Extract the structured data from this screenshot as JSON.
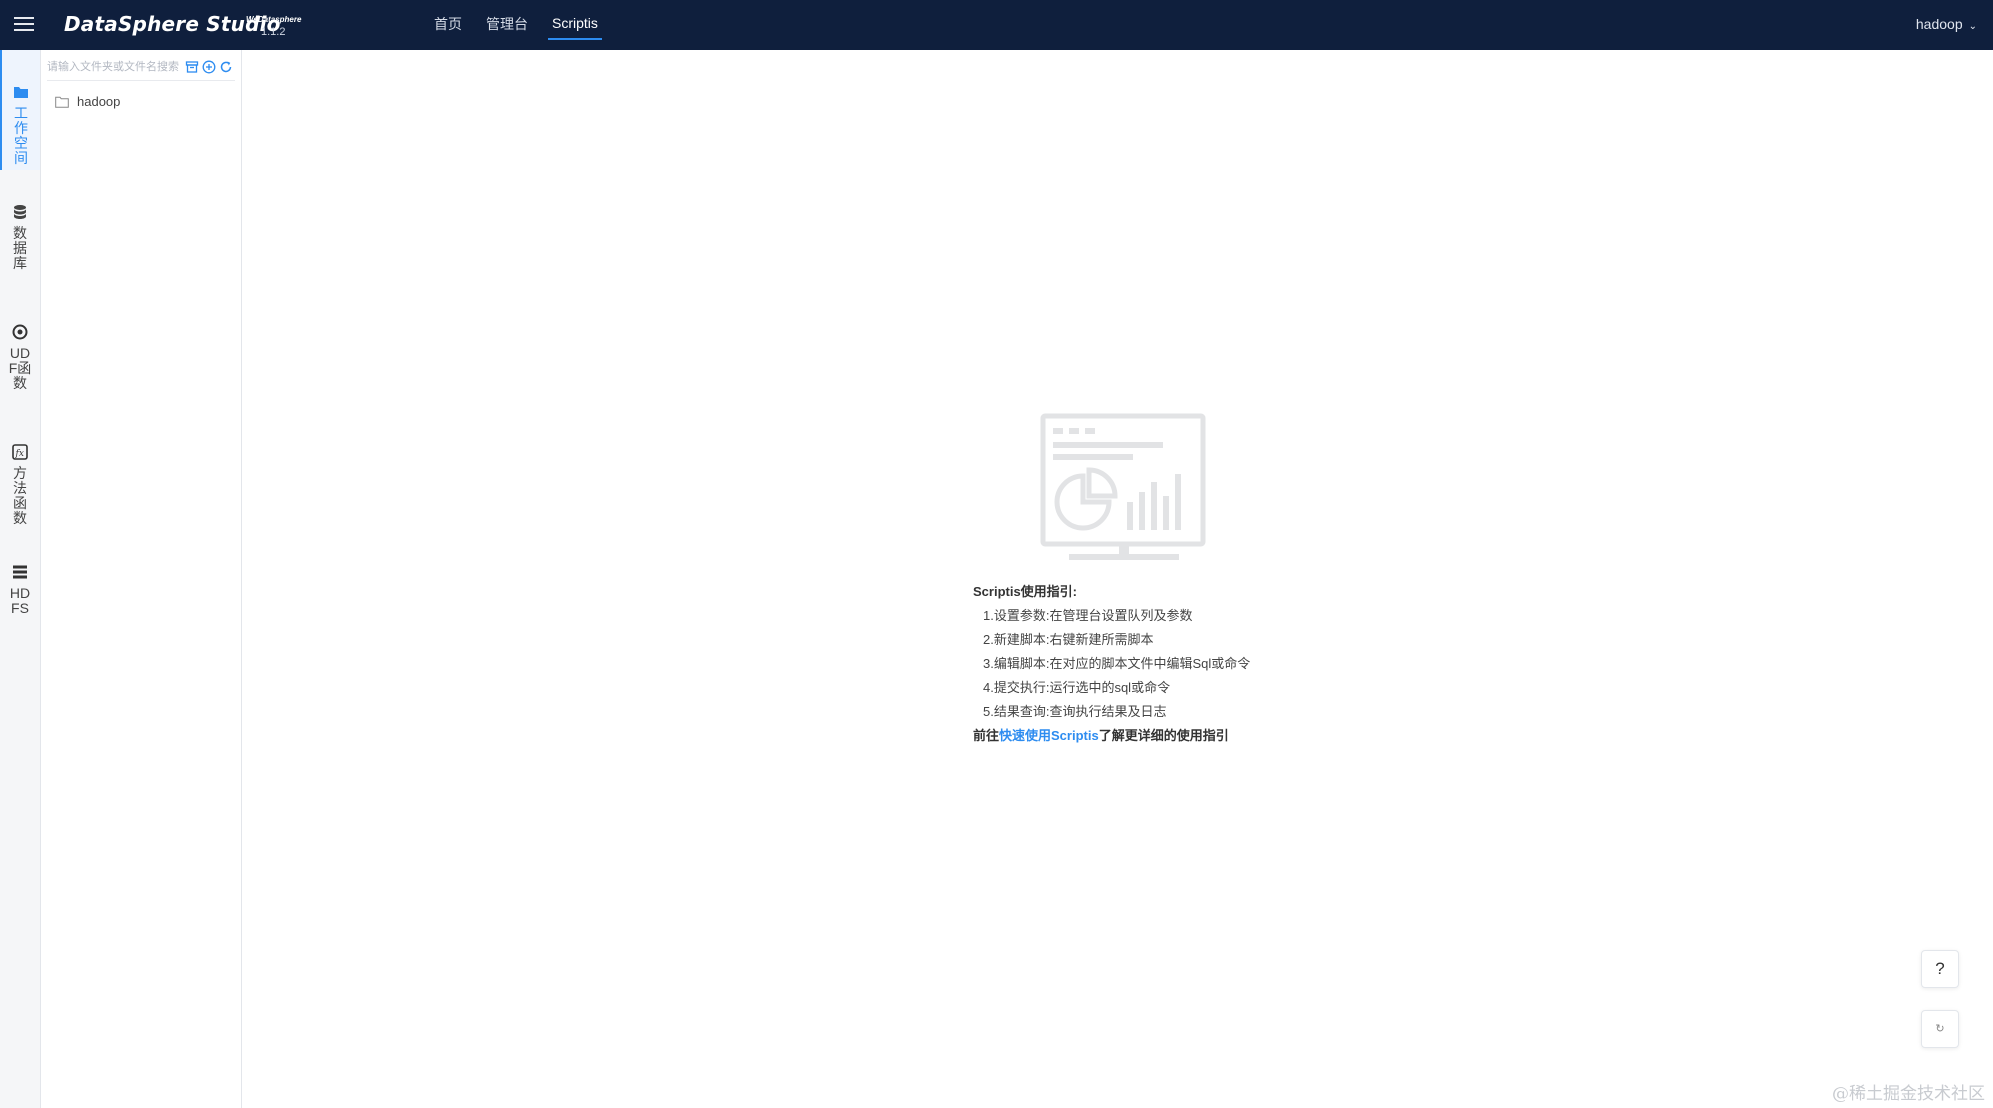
{
  "header": {
    "menu_icon": "hamburger-icon",
    "brand": "DataSphere Studio",
    "brand_sub": "WeDatasphere",
    "version": "1.1.2",
    "nav": [
      {
        "label": "首页",
        "active": false
      },
      {
        "label": "管理台",
        "active": false
      },
      {
        "label": "Scriptis",
        "active": true
      }
    ],
    "user": "hadoop",
    "accent_color": "#2d8cf0",
    "bar_color": "#0f1f3d"
  },
  "rail": {
    "items": [
      {
        "label": "工作空间",
        "icon": "folder-icon",
        "active": true
      },
      {
        "label": "数据库",
        "icon": "database-icon",
        "active": false
      },
      {
        "label": "UDF函数",
        "icon": "udf-icon",
        "active": false
      },
      {
        "label": "方法函数",
        "icon": "function-icon",
        "active": false
      },
      {
        "label": "HDFS",
        "icon": "hdfs-icon",
        "active": false
      }
    ]
  },
  "panel": {
    "search_placeholder": "请输入文件夹或文件名搜索",
    "tools": [
      "archive-icon",
      "add-circle-icon",
      "refresh-icon"
    ],
    "tree": [
      {
        "label": "hadoop",
        "icon": "folder-outline-icon"
      }
    ]
  },
  "guide": {
    "title": "Scriptis使用指引:",
    "steps": [
      "1.设置参数:在管理台设置队列及参数",
      "2.新建脚本:右键新建所需脚本",
      "3.编辑脚本:在对应的脚本文件中编辑Sql或命令",
      "4.提交执行:运行选中的sql或命令",
      "5.结果查询:查询执行结果及日志"
    ],
    "footer_prefix": "前往",
    "footer_link": "快速使用Scriptis",
    "footer_suffix": "了解更详细的使用指引"
  },
  "floating": {
    "help": "?",
    "secondary": "↻"
  },
  "watermark": "@稀土掘金技术社区"
}
